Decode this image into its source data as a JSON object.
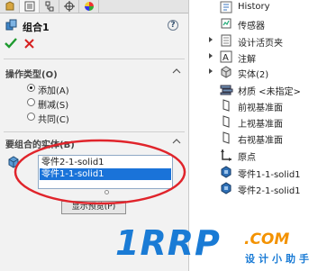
{
  "property_manager": {
    "tabs": [
      "feature-manager-tab",
      "property-manager-tab",
      "configuration-manager-tab",
      "dim-xpert-tab",
      "display-manager-tab"
    ],
    "title": "组合1",
    "help": "?",
    "operation_type": {
      "header": "操作类型(O)",
      "options": [
        {
          "label": "添加(A)",
          "checked": true
        },
        {
          "label": "删减(S)",
          "checked": false
        },
        {
          "label": "共同(C)",
          "checked": false
        }
      ]
    },
    "bodies_to_combine": {
      "header": "要组合的实体(B)",
      "items": [
        {
          "label": "零件2-1-solid1",
          "selected": false
        },
        {
          "label": "零件1-1-solid1",
          "selected": true
        }
      ]
    },
    "preview_button": "显示预览(P)"
  },
  "feature_tree": {
    "items": [
      {
        "label": "History",
        "icon": "history-icon",
        "expandable": false
      },
      {
        "label": "传感器",
        "icon": "sensors-icon",
        "expandable": false
      },
      {
        "label": "设计活页夹",
        "icon": "design-binder-icon",
        "expandable": true
      },
      {
        "label": "注解",
        "icon": "annotations-icon",
        "expandable": true
      },
      {
        "label": "实体(2)",
        "icon": "solid-bodies-icon",
        "expandable": true
      },
      {
        "label": "材质 <未指定>",
        "icon": "material-icon",
        "expandable": false
      },
      {
        "label": "前视基准面",
        "icon": "plane-icon",
        "expandable": false
      },
      {
        "label": "上视基准面",
        "icon": "plane-icon",
        "expandable": false
      },
      {
        "label": "右视基准面",
        "icon": "plane-icon",
        "expandable": false
      },
      {
        "label": "原点",
        "icon": "origin-icon",
        "expandable": false
      },
      {
        "label": "零件1-1-solid1",
        "icon": "body-feature-icon",
        "expandable": false
      },
      {
        "label": "零件2-1-solid1",
        "icon": "body-feature-icon",
        "expandable": false
      }
    ]
  },
  "watermark": {
    "main": "1RRP",
    "com": ".COM",
    "sub": "设计小助手"
  },
  "colors": {
    "selection": "#1a73d9",
    "annotation_ellipse": "#e0242b",
    "watermark_blue": "#1a7bd5",
    "watermark_orange": "#f39200"
  }
}
